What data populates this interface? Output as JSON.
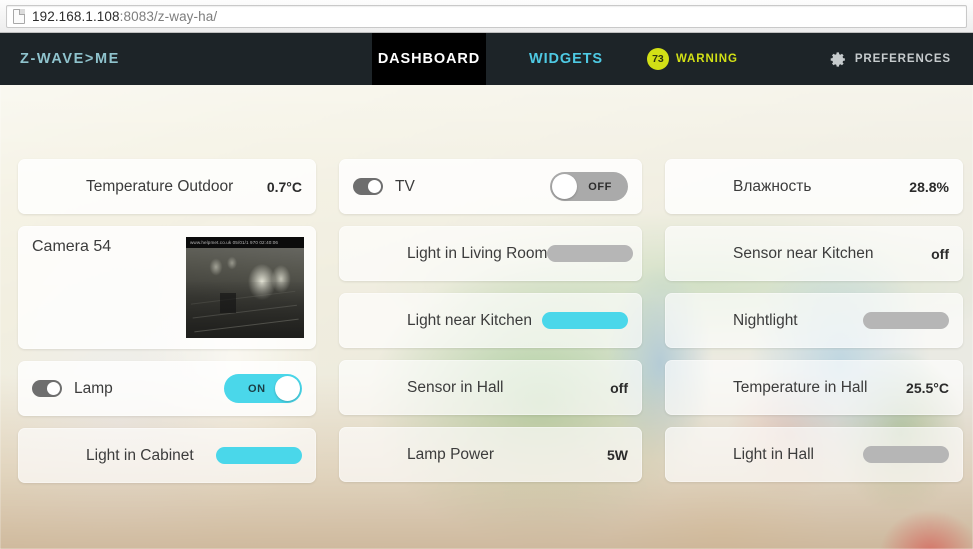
{
  "browser": {
    "url_host": "192.168.1.108",
    "url_rest": ":8083/z-way-ha/",
    "page_icon": "document-icon"
  },
  "nav": {
    "logo": "Z-WAVE>ME",
    "tabs": [
      {
        "label": "DASHBOARD",
        "active": true
      },
      {
        "label": "WIDGETS",
        "active": false
      }
    ],
    "warning": {
      "count": "73",
      "label": "WARNING",
      "color": "#d2e016"
    },
    "preferences": {
      "label": "PREFERENCES",
      "icon": "gear-icon"
    },
    "accent": "#4ec9e3",
    "bar_bg": "#1d2428"
  },
  "columns": [
    {
      "widgets": [
        {
          "name": "temperature-outdoor",
          "label": "Temperature Outdoor",
          "control": "value",
          "value": "0.7°C"
        },
        {
          "name": "camera-54",
          "label": "Camera 54",
          "control": "camera",
          "camera_overlay": "www.helpmet.co.uk 05/01/1 970 02:40:06"
        },
        {
          "name": "lamp",
          "label": "Lamp",
          "control": "switch",
          "state": "on",
          "state_label": "ON",
          "has_mini_toggle": true
        },
        {
          "name": "light-in-cabinet",
          "label": "Light in Cabinet",
          "control": "slider",
          "slider_color": "cyan"
        }
      ]
    },
    {
      "widgets": [
        {
          "name": "tv",
          "label": "TV",
          "control": "switch",
          "state": "off",
          "state_label": "OFF",
          "has_mini_toggle": true
        },
        {
          "name": "light-in-living-room",
          "label": "Light in Living Room",
          "control": "slider",
          "slider_color": "gray"
        },
        {
          "name": "light-near-kitchen",
          "label": "Light near Kitchen",
          "control": "slider",
          "slider_color": "cyan"
        },
        {
          "name": "sensor-in-hall",
          "label": "Sensor in Hall",
          "control": "value",
          "value": "off"
        },
        {
          "name": "lamp-power",
          "label": "Lamp Power",
          "control": "value",
          "value": "5W"
        }
      ]
    },
    {
      "widgets": [
        {
          "name": "humidity",
          "label": "Влажность",
          "control": "value",
          "value": "28.8%"
        },
        {
          "name": "sensor-near-kitchen",
          "label": "Sensor near Kitchen",
          "control": "value",
          "value": "off"
        },
        {
          "name": "nightlight",
          "label": "Nightlight",
          "control": "slider",
          "slider_color": "gray"
        },
        {
          "name": "temperature-in-hall",
          "label": "Temperature in Hall",
          "control": "value",
          "value": "25.5°C"
        },
        {
          "name": "light-in-hall",
          "label": "Light in Hall",
          "control": "slider",
          "slider_color": "gray"
        }
      ]
    }
  ],
  "colors": {
    "cyan": "#4ad7ea",
    "gray_slider": "#b6b6b6",
    "switch_off": "#aaaaaa"
  }
}
